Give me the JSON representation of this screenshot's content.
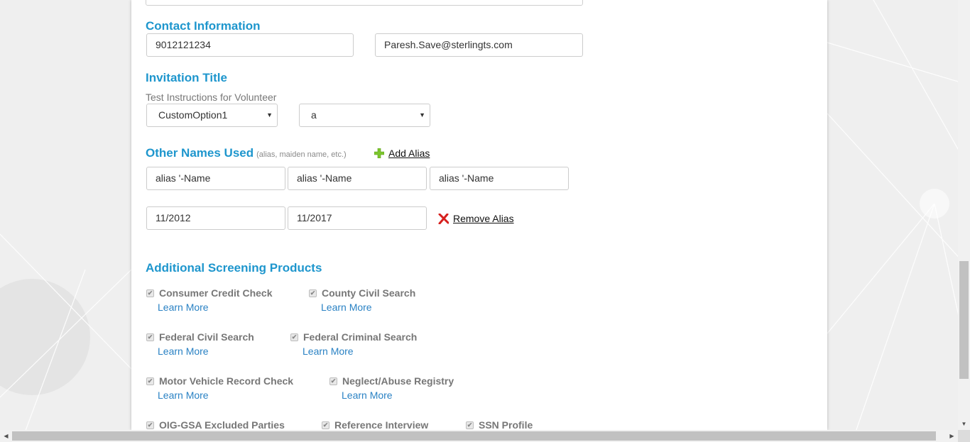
{
  "contact": {
    "title": "Contact Information",
    "phone": "9012121234",
    "email": "Paresh.Save@sterlingts.com"
  },
  "invitation": {
    "title": "Invitation Title",
    "hint": "Test Instructions for Volunteer",
    "select1": "CustomOption1",
    "select2": "a"
  },
  "other_names": {
    "title": "Other Names Used",
    "subtitle": "(alias, maiden name, etc.)",
    "add_alias": "Add Alias",
    "alias_first": "alias '-Name",
    "alias_middle": "alias '-Name",
    "alias_last": "alias '-Name",
    "date_from": "11/2012",
    "date_to": "11/2017",
    "remove_alias": "Remove Alias"
  },
  "screening": {
    "title": "Additional Screening Products",
    "learn_more": "Learn More",
    "products": [
      "Consumer Credit Check",
      "County Civil Search",
      "Federal Civil Search",
      "Federal Criminal Search",
      "Motor Vehicle Record Check",
      "Neglect/Abuse Registry",
      "OIG-GSA Excluded Parties",
      "Reference Interview",
      "SSN Profile"
    ]
  },
  "icons": {
    "add": "plus-icon",
    "remove": "x-icon",
    "checkbox": "checkmark-icon",
    "select_caret": "caret-down-icon"
  },
  "colors": {
    "section_title": "#1e96cd",
    "link": "#2a82c4",
    "add_icon": "#7cc62e",
    "remove_icon": "#d6201e"
  }
}
